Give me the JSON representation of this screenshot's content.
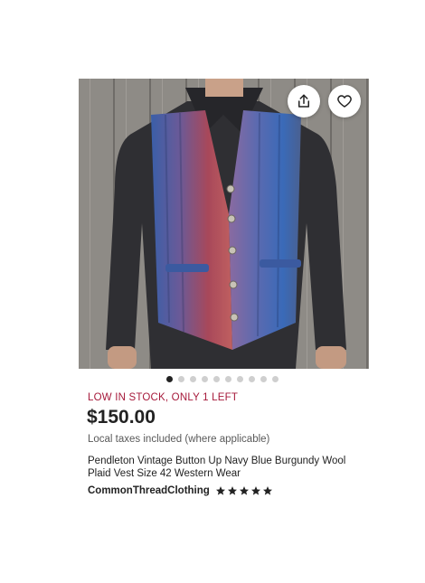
{
  "listing": {
    "stock_notice": "LOW IN STOCK, ONLY 1 LEFT",
    "price": "$150.00",
    "tax_note": "Local taxes included (where applicable)",
    "title": "Pendleton Vintage Button Up Navy Blue Burgundy Wool Plaid Vest Size 42 Western Wear",
    "shop_name": "CommonThreadClothing",
    "rating": 5,
    "rating_max": 5
  },
  "carousel": {
    "image_count": 10,
    "active_index": 1
  },
  "icons": {
    "share": "share-icon",
    "favorite": "heart-icon",
    "star": "star-icon"
  },
  "colors": {
    "accent_stock": "#a61a3b",
    "text_primary": "#222222",
    "text_secondary": "#595959"
  }
}
